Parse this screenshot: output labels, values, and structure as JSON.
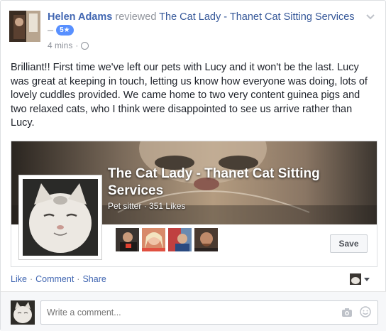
{
  "post": {
    "author": "Helen Adams",
    "verb": "reviewed",
    "page_name": "The Cat Lady - Thanet Cat Sitting Services",
    "dash": "–",
    "rating": "5★",
    "time": "4 mins",
    "sep": "·",
    "text": "Brilliant!! First time we've left our pets with Lucy and it won't be the last. Lucy was great at keeping in touch, letting us know how everyone was doing, lots of lovely cuddles provided. We came home to two very content guinea pigs and two relaxed cats, who I think were disappointed to see us arrive rather than Lucy."
  },
  "card": {
    "title": "The Cat Lady - Thanet Cat Sitting Services",
    "category": "Pet sitter",
    "dot": "·",
    "likes": "351 Likes",
    "save_label": "Save"
  },
  "actions": {
    "like": "Like",
    "comment": "Comment",
    "share": "Share",
    "dot": "·"
  },
  "comment_box": {
    "placeholder": "Write a comment..."
  },
  "icons": {
    "options": "chevron-down-icon",
    "audience": "globe-icon",
    "camera": "camera-icon",
    "emoji": "smiley-icon"
  },
  "colors": {
    "link": "#4267b2",
    "muted": "#90949c",
    "badge": "#5890ff",
    "text": "#1d2129"
  }
}
